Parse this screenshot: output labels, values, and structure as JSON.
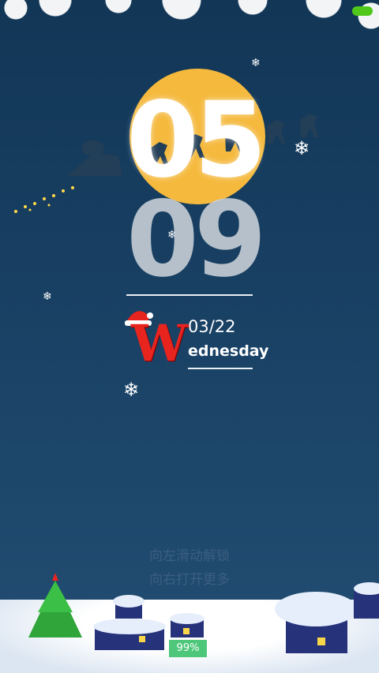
{
  "clock": {
    "hours": "05",
    "minutes": "09"
  },
  "date": {
    "text": "03/22",
    "weekday_initial": "W",
    "weekday_rest": "ednesday"
  },
  "unlock": {
    "left_hint": "向左滑动解锁",
    "right_hint": "向右打开更多"
  },
  "battery": {
    "percent_label": "99%"
  },
  "colors": {
    "moon": "#f5b93d",
    "battery_green": "#50c81a",
    "accent_red": "#e8241f"
  },
  "icons": [
    "battery-icon",
    "snowflake-icon",
    "sleigh-icon",
    "santa-hat-icon",
    "christmas-tree-icon",
    "snow-house-icon"
  ]
}
